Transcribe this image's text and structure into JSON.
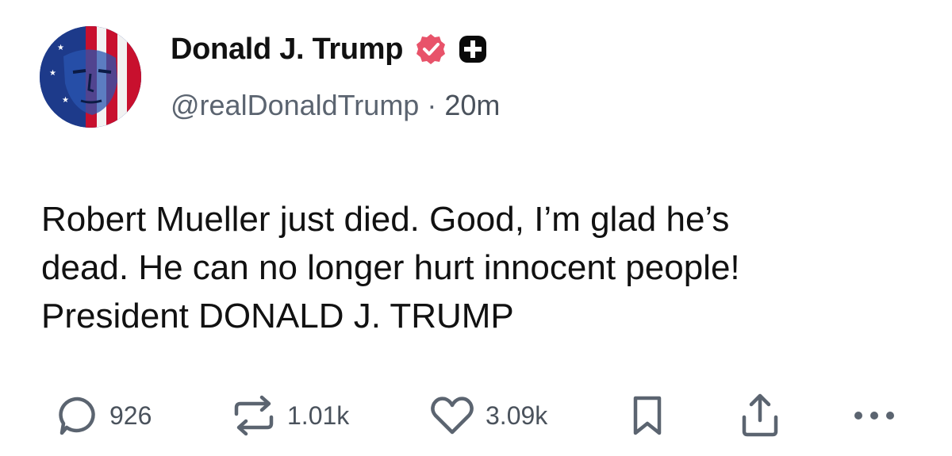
{
  "author": {
    "display_name": "Donald J. Trump",
    "handle": "@realDonaldTrump",
    "separator": "·",
    "time_ago": "20m",
    "verified_color": "#e8536a"
  },
  "post": {
    "lines": [
      "Robert Mueller just died. Good, I’m glad he’s",
      "dead. He can no longer hurt innocent people!",
      "President DONALD J. TRUMP"
    ]
  },
  "actions": {
    "replies": "926",
    "reposts": "1.01k",
    "likes": "3.09k"
  },
  "icons": [
    "verified-badge-icon",
    "plus-badge-icon",
    "reply-icon",
    "repost-icon",
    "like-icon",
    "bookmark-icon",
    "share-icon",
    "more-icon"
  ]
}
